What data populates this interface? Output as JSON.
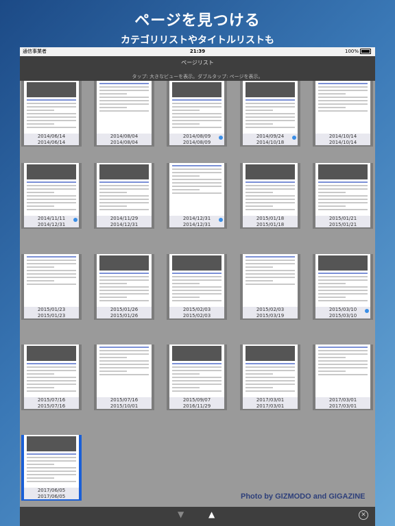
{
  "promo": {
    "headline": "ページを見つける",
    "subline": "カテゴリリストやタイトルリストも"
  },
  "status_bar": {
    "carrier": "通信事業者",
    "time": "21:39",
    "battery": "100%"
  },
  "nav": {
    "title": "ページリスト",
    "hint": "タップ: 大きなビューを表示。ダブルタップ: ページを表示。"
  },
  "pages": [
    {
      "date1": "2014/06/14",
      "date2": "2014/06/14",
      "marked": false
    },
    {
      "date1": "2014/08/04",
      "date2": "2014/08/04",
      "marked": false
    },
    {
      "date1": "2014/08/09",
      "date2": "2014/08/09",
      "marked": true
    },
    {
      "date1": "2014/09/24",
      "date2": "2014/10/18",
      "marked": true
    },
    {
      "date1": "2014/10/14",
      "date2": "2014/10/14",
      "marked": false
    },
    {
      "date1": "2014/11/11",
      "date2": "2014/12/31",
      "marked": true
    },
    {
      "date1": "2014/11/29",
      "date2": "2014/12/31",
      "marked": false
    },
    {
      "date1": "2014/12/31",
      "date2": "2014/12/31",
      "marked": true
    },
    {
      "date1": "2015/01/18",
      "date2": "2015/01/18",
      "marked": false
    },
    {
      "date1": "2015/01/21",
      "date2": "2015/01/21",
      "marked": false
    },
    {
      "date1": "2015/01/23",
      "date2": "2015/01/23",
      "marked": false
    },
    {
      "date1": "2015/01/26",
      "date2": "2015/01/26",
      "marked": false
    },
    {
      "date1": "2015/02/03",
      "date2": "2015/02/03",
      "marked": false
    },
    {
      "date1": "2015/02/03",
      "date2": "2015/03/19",
      "marked": false
    },
    {
      "date1": "2015/03/10",
      "date2": "2015/03/10",
      "marked": true
    },
    {
      "date1": "2015/07/16",
      "date2": "2015/07/16",
      "marked": false
    },
    {
      "date1": "2015/07/16",
      "date2": "2015/10/01",
      "marked": false
    },
    {
      "date1": "2015/09/07",
      "date2": "2016/11/29",
      "marked": false
    },
    {
      "date1": "2017/03/01",
      "date2": "2017/03/01",
      "marked": false
    },
    {
      "date1": "2017/03/01",
      "date2": "2017/03/01",
      "marked": false
    },
    {
      "date1": "2017/06/05",
      "date2": "2017/06/05",
      "marked": false,
      "selected": true
    }
  ],
  "toolbar": {
    "down_icon": "triangle-down-icon",
    "up_icon": "triangle-up-icon",
    "close_icon": "close-circle-icon"
  },
  "credit": "Photo by GIZMODO and GIGAZINE",
  "colors": {
    "accent_dot": "#3a8ee6",
    "selected_border": "#1a5fd6"
  }
}
